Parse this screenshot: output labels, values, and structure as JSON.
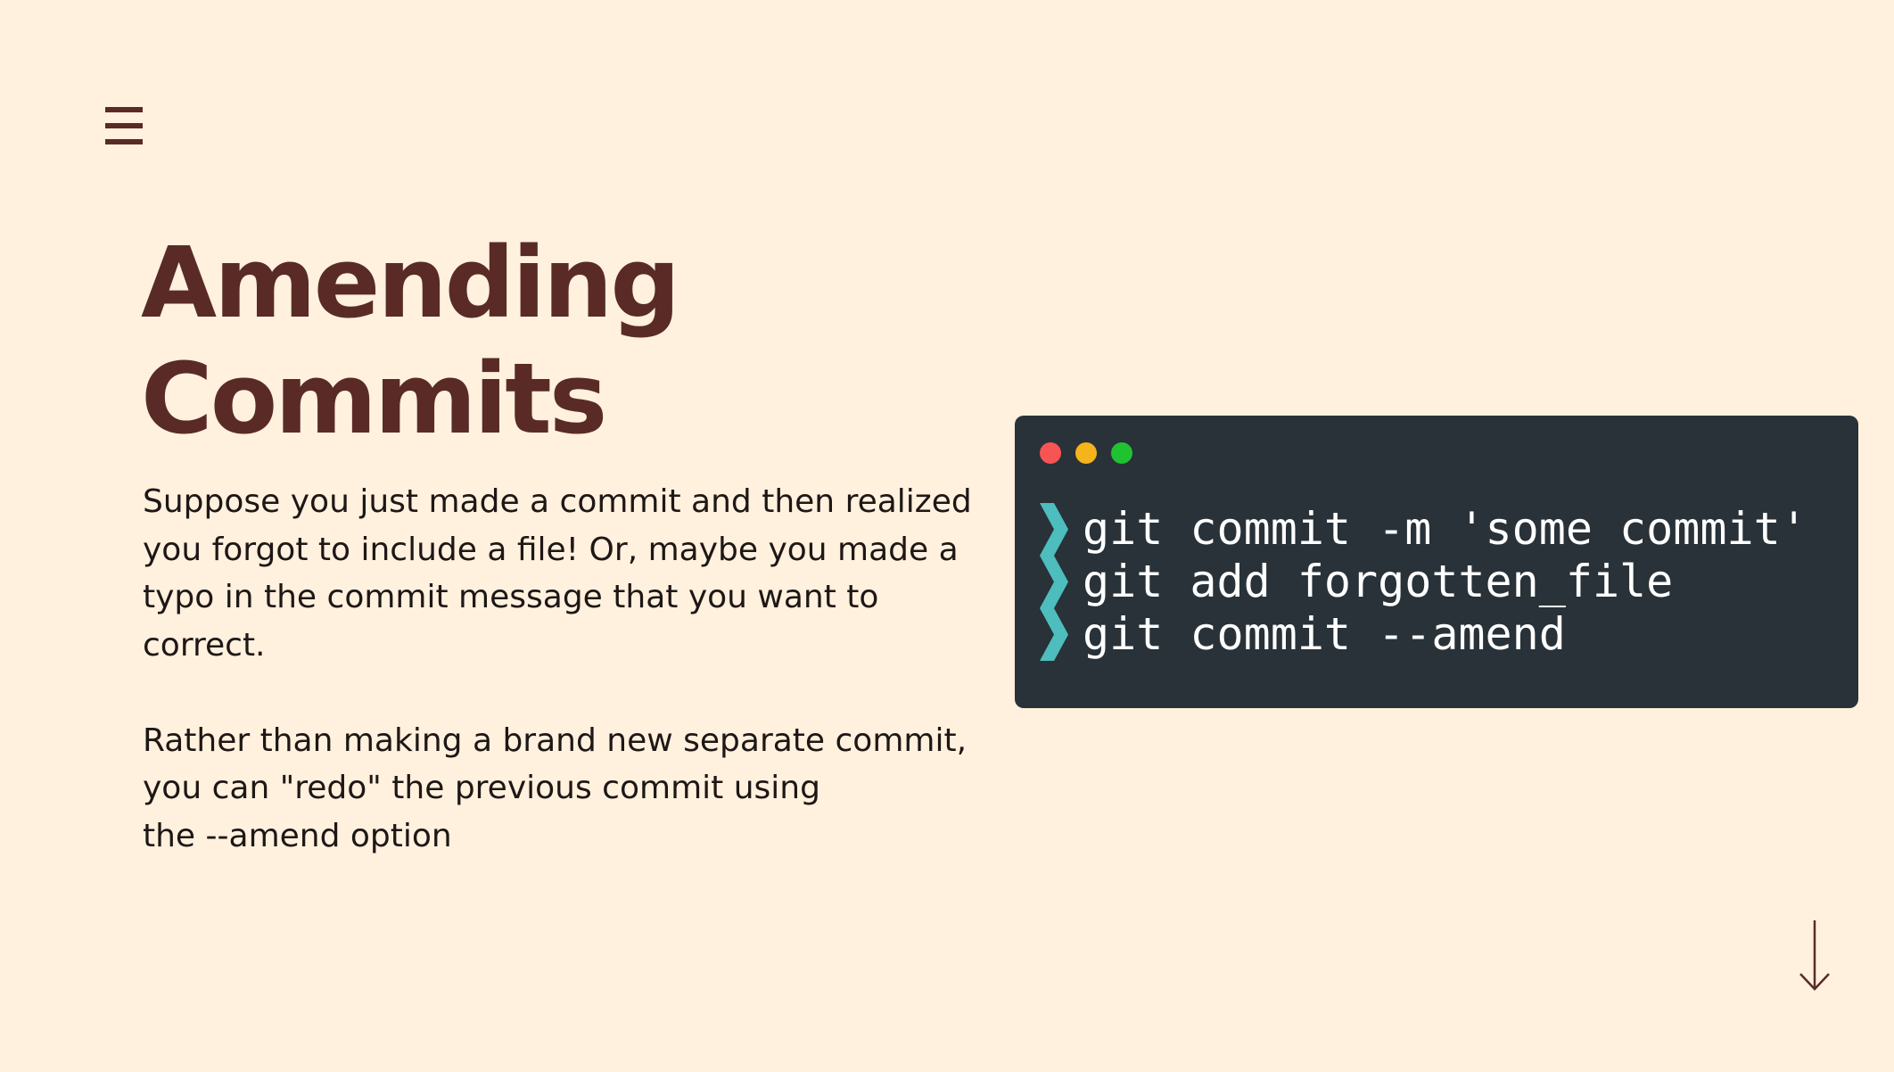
{
  "slide": {
    "title_lines": [
      "Amending",
      "Commits"
    ],
    "paragraphs": [
      {
        "lines": [
          "Suppose you just made a commit and then realized",
          "you forgot to include a file! Or, maybe you made a",
          "typo in the commit message that you want to",
          "correct."
        ]
      },
      {
        "lines": [
          "Rather than making a brand new separate commit,",
          "you can \"redo\" the previous commit using",
          "the --amend option"
        ]
      }
    ]
  },
  "terminal": {
    "commands": [
      "git commit -m 'some commit'",
      "git add forgotten_file",
      "git commit --amend"
    ],
    "prompt_icon": "chevron-right-icon",
    "window_dots": [
      "#f85454",
      "#f5b31c",
      "#20c232"
    ]
  },
  "icons": {
    "menu": "hamburger-menu-icon",
    "scroll": "arrow-down-icon"
  },
  "colors": {
    "background": "#fff1de",
    "title": "#5a2b26",
    "body_text": "#1e1715",
    "terminal_bg": "#283238",
    "prompt": "#4dbdbe",
    "command_text": "#ffffff"
  }
}
